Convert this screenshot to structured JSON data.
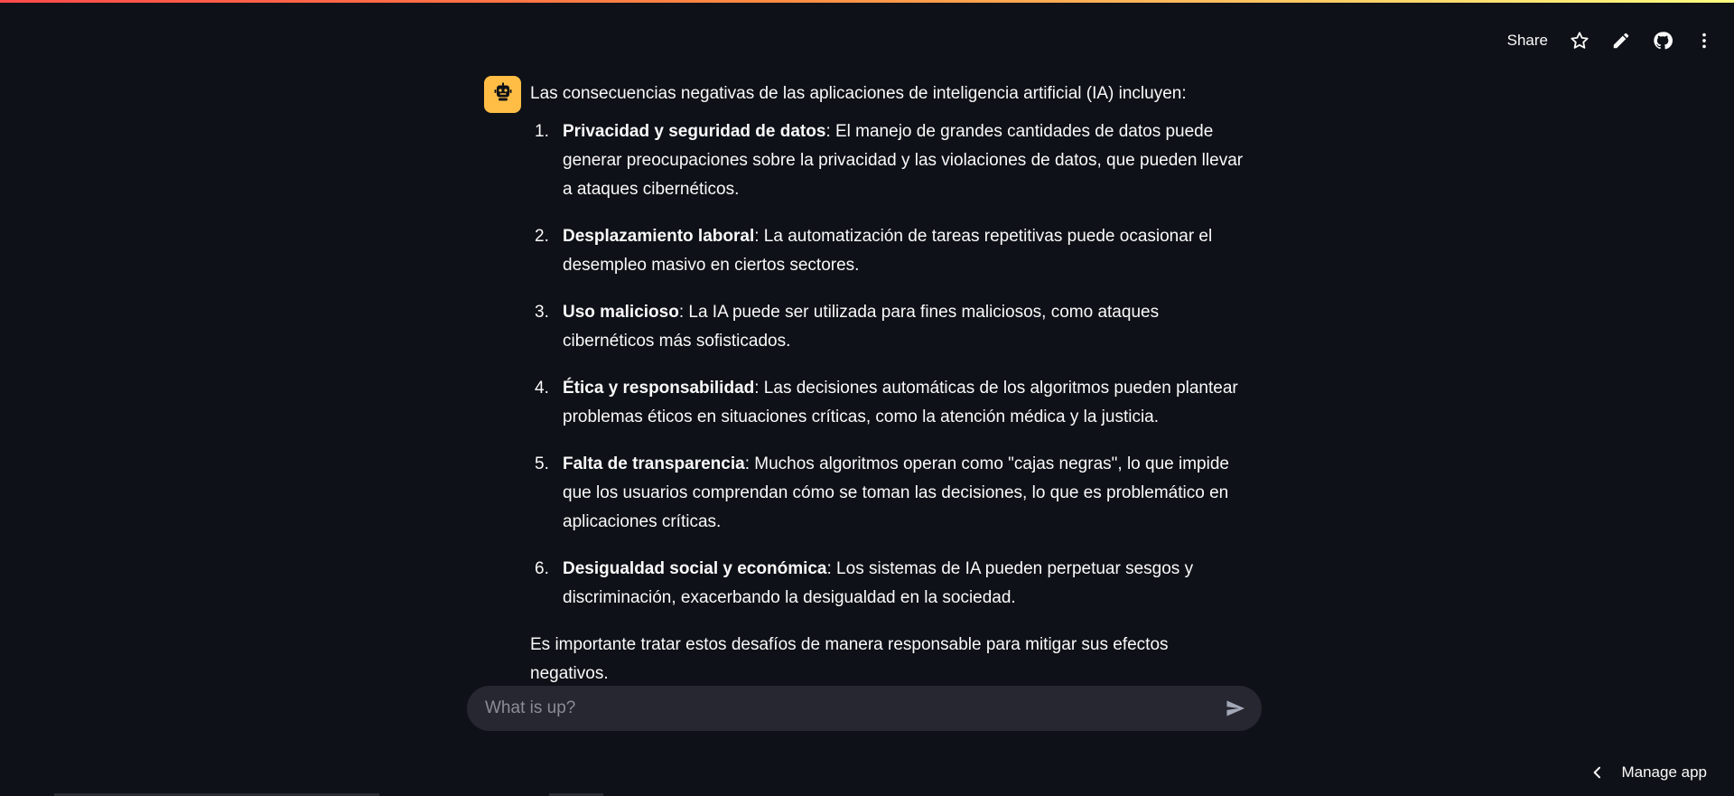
{
  "header": {
    "share_label": "Share",
    "icons": [
      "star-icon",
      "pencil-icon",
      "github-icon",
      "more-vertical-icon"
    ]
  },
  "message": {
    "avatar_icon": "robot-icon",
    "avatar_color": "#ffbd45",
    "intro": "Las consecuencias negativas de las aplicaciones de inteligencia artificial (IA) incluyen:",
    "items": [
      {
        "num": "1.",
        "title": "Privacidad y seguridad de datos",
        "text": ": El manejo de grandes cantidades de datos puede generar preocupaciones sobre la privacidad y las violaciones de datos, que pueden llevar a ataques cibernéticos."
      },
      {
        "num": "2.",
        "title": "Desplazamiento laboral",
        "text": ": La automatización de tareas repetitivas puede ocasionar el desempleo masivo en ciertos sectores."
      },
      {
        "num": "3.",
        "title": "Uso malicioso",
        "text": ": La IA puede ser utilizada para fines maliciosos, como ataques cibernéticos más sofisticados."
      },
      {
        "num": "4.",
        "title": "Ética y responsabilidad",
        "text": ": Las decisiones automáticas de los algoritmos pueden plantear problemas éticos en situaciones críticas, como la atención médica y la justicia."
      },
      {
        "num": "5.",
        "title": "Falta de transparencia",
        "text": ": Muchos algoritmos operan como \"cajas negras\", lo que impide que los usuarios comprendan cómo se toman las decisiones, lo que es problemático en aplicaciones críticas."
      },
      {
        "num": "6.",
        "title": "Desigualdad social y económica",
        "text": ": Los sistemas de IA pueden perpetuar sesgos y discriminación, exacerbando la desigualdad en la sociedad."
      }
    ],
    "outro": "Es importante tratar estos desafíos de manera responsable para mitigar sus efectos negativos."
  },
  "chat_input": {
    "placeholder": "What is up?",
    "value": "",
    "send_icon": "send-icon"
  },
  "footer": {
    "manage_label": "Manage app",
    "manage_icon": "chevron-left-icon"
  },
  "colors": {
    "background": "#0e1117",
    "input_background": "#262730",
    "text": "#fafafa"
  }
}
